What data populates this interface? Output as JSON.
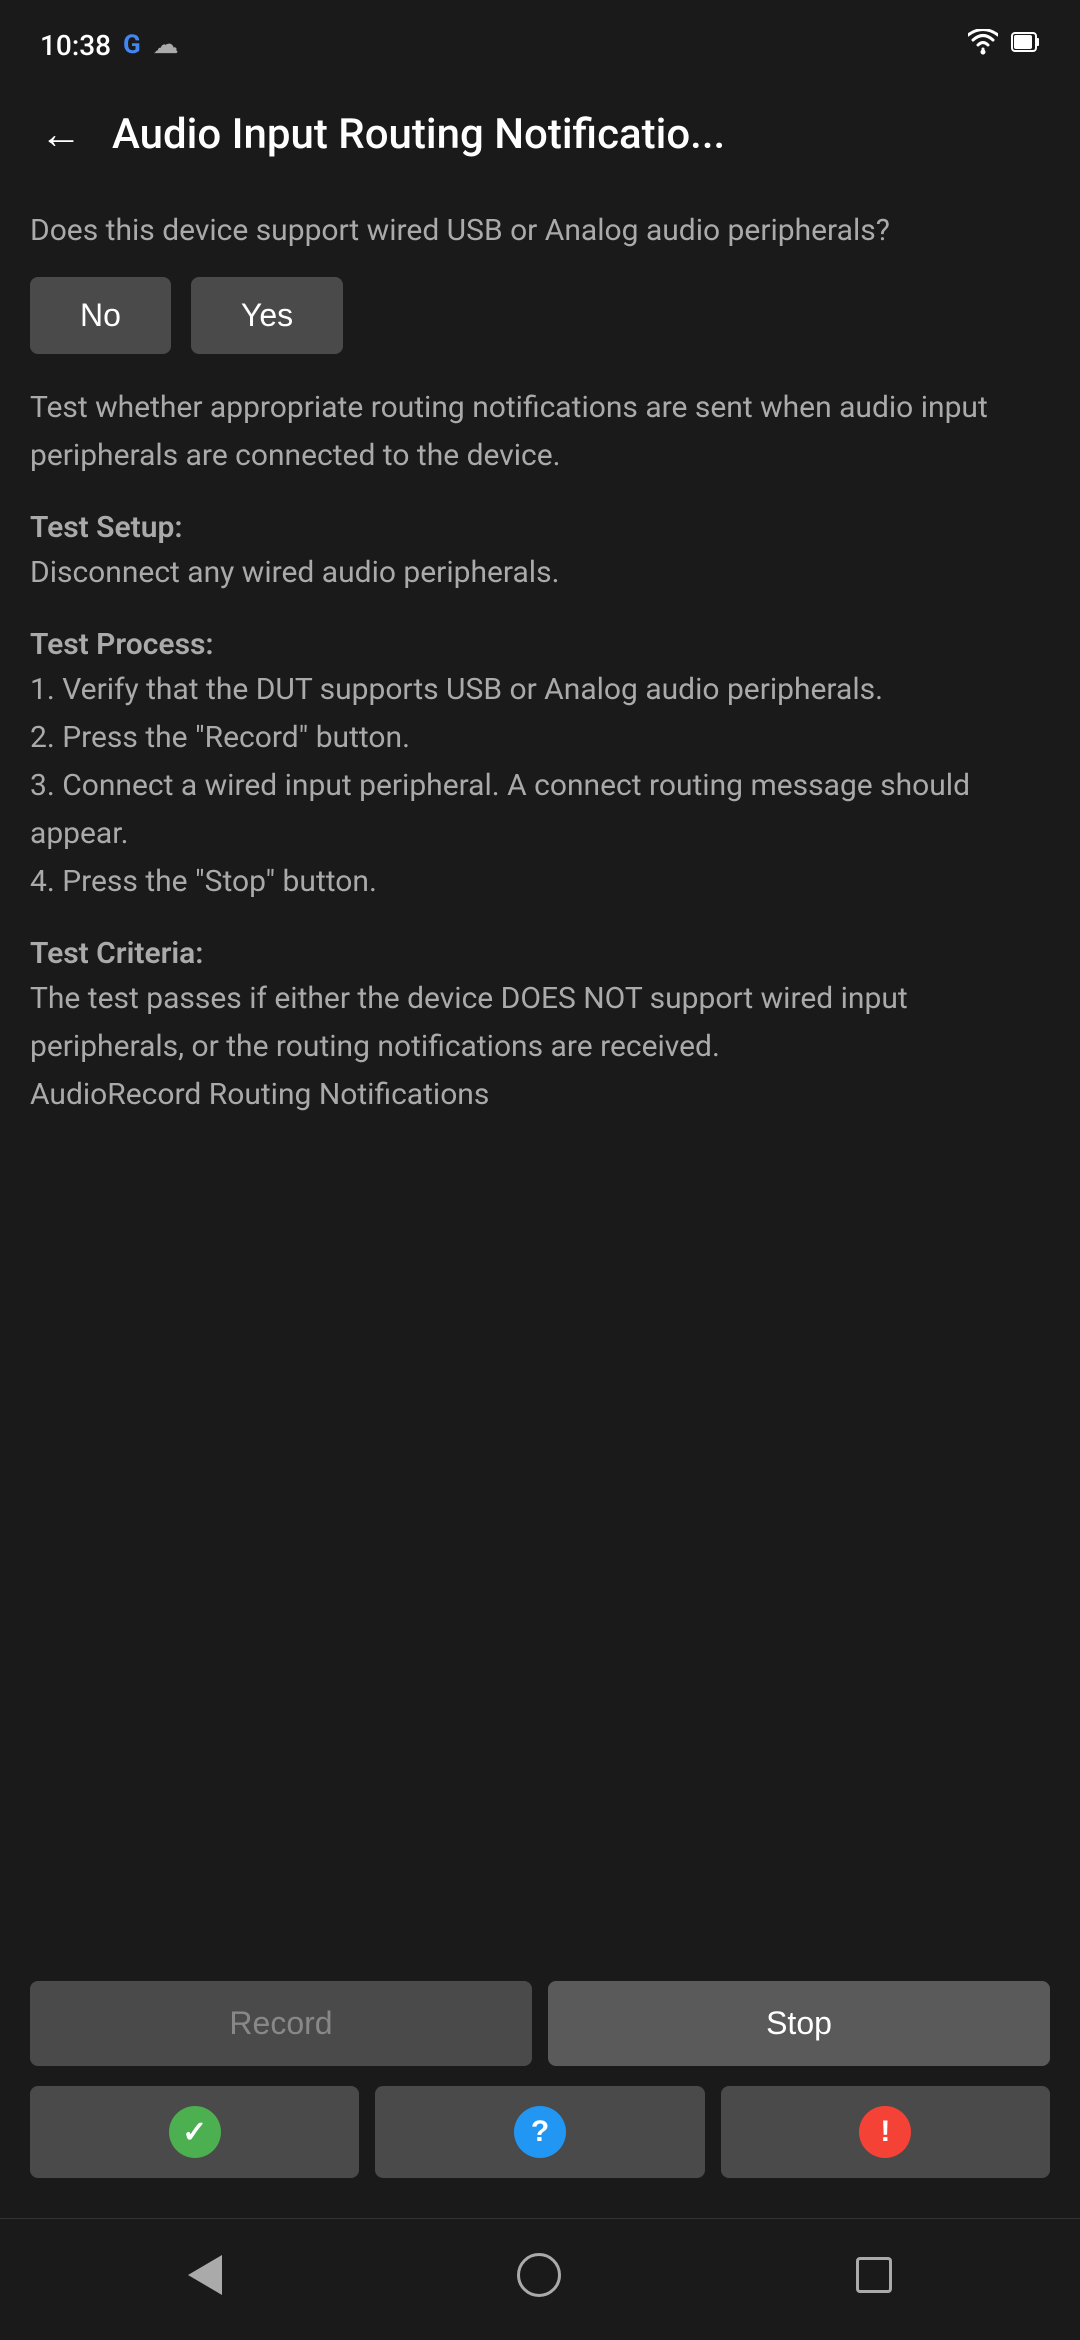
{
  "statusBar": {
    "time": "10:38",
    "googleLabel": "G",
    "cloudSymbol": "☁",
    "wifiSymbol": "▾",
    "batterySymbol": "▮"
  },
  "header": {
    "backArrow": "←",
    "title": "Audio Input Routing Notificatio..."
  },
  "content": {
    "question": "Does this device support wired USB or Analog audio peripherals?",
    "buttons": {
      "no": "No",
      "yes": "Yes"
    },
    "description": "Test whether appropriate routing notifications are sent when audio input peripherals are connected to the device.",
    "testSetup": {
      "label": "Test Setup:",
      "text": "Disconnect any wired audio peripherals."
    },
    "testProcess": {
      "label": "Test Process:",
      "steps": [
        "1. Verify that the DUT supports USB or Analog audio peripherals.",
        "2. Press the \"Record\" button.",
        "3. Connect a wired input peripheral. A connect routing message should appear.",
        "4. Press the \"Stop\" button."
      ]
    },
    "testCriteria": {
      "label": "Test Criteria:",
      "text": "The test passes if either the device DOES NOT support wired input peripherals, or the routing notifications are received.",
      "footer": "AudioRecord Routing Notifications"
    }
  },
  "actionButtons": {
    "record": "Record",
    "stop": "Stop"
  },
  "resultButtons": {
    "pass": "✓",
    "question": "?",
    "fail": "!"
  },
  "navBar": {
    "back": "back",
    "home": "home",
    "recent": "recent"
  }
}
